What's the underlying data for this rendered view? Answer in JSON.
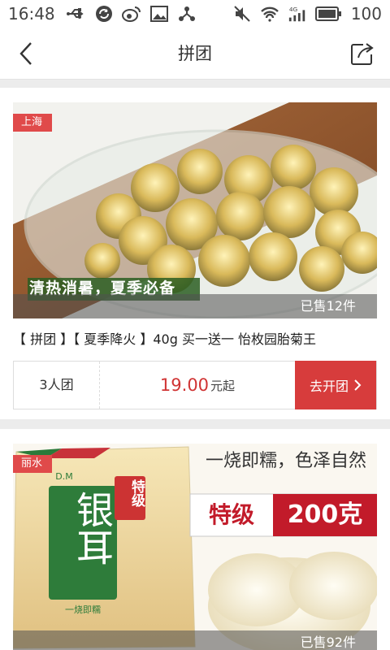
{
  "status_bar": {
    "time": "16:48",
    "battery_level": "100",
    "left_icons": [
      "usb-icon",
      "sync-icon",
      "weibo-icon",
      "image-icon",
      "share-network-icon"
    ],
    "right_icons": [
      "mute-icon",
      "wifi-icon",
      "signal-4g-icon",
      "battery-icon"
    ]
  },
  "nav": {
    "title": "拼团",
    "back_icon": "back-chevron-icon",
    "share_icon": "share-icon"
  },
  "products": [
    {
      "location": "上海",
      "sold": "已售12件",
      "image_caption": "清热消暑，夏季必备",
      "title": "【 拼团 】【 夏季降火 】40g 买一送一 怡枚园胎菊王",
      "group_size": "3人团",
      "price": "19.00",
      "price_suffix": "元起",
      "button_label": "去开团",
      "image_desc": "chrysanthemum-tea-bowl"
    },
    {
      "location": "丽水",
      "sold": "已售92件",
      "banner_slogan": "一烧即糯，色泽自然",
      "banner_grade": "特级",
      "banner_weight": "200克",
      "package_label_top": "特级",
      "package_label_main": "银耳",
      "package_brand": "D.M",
      "package_footer": "一烧即糯",
      "image_desc": "white-fungus-package"
    }
  ],
  "colors": {
    "accent": "#d73c3c",
    "price": "#d03434",
    "background": "#ececec"
  }
}
